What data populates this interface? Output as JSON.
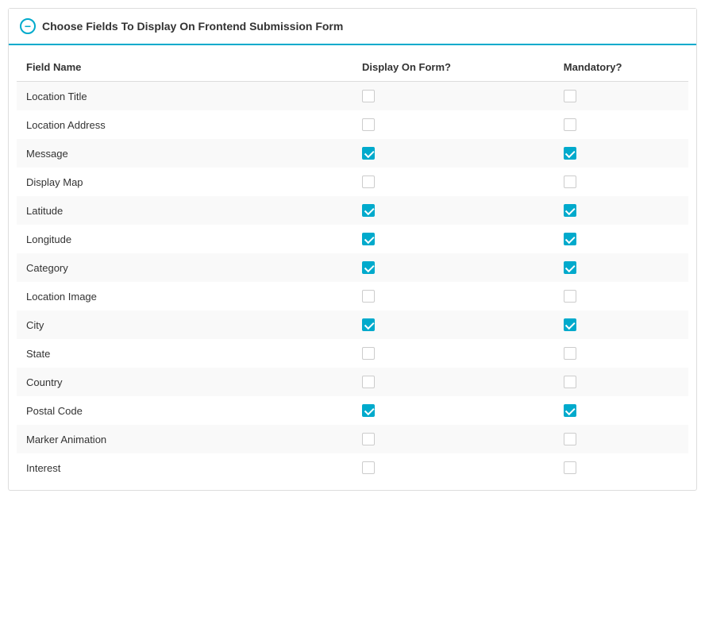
{
  "panel": {
    "title": "Choose Fields To Display On Frontend Submission Form",
    "icon_label": "−"
  },
  "table": {
    "headers": [
      "Field Name",
      "Display On Form?",
      "Mandatory?"
    ],
    "rows": [
      {
        "field": "Location Title",
        "display": false,
        "mandatory": false
      },
      {
        "field": "Location Address",
        "display": false,
        "mandatory": false
      },
      {
        "field": "Message",
        "display": true,
        "mandatory": true
      },
      {
        "field": "Display Map",
        "display": false,
        "mandatory": false
      },
      {
        "field": "Latitude",
        "display": true,
        "mandatory": true
      },
      {
        "field": "Longitude",
        "display": true,
        "mandatory": true
      },
      {
        "field": "Category",
        "display": true,
        "mandatory": true
      },
      {
        "field": "Location Image",
        "display": false,
        "mandatory": false
      },
      {
        "field": "City",
        "display": true,
        "mandatory": true
      },
      {
        "field": "State",
        "display": false,
        "mandatory": false
      },
      {
        "field": "Country",
        "display": false,
        "mandatory": false
      },
      {
        "field": "Postal Code",
        "display": true,
        "mandatory": true
      },
      {
        "field": "Marker Animation",
        "display": false,
        "mandatory": false
      },
      {
        "field": "Interest",
        "display": false,
        "mandatory": false
      }
    ]
  }
}
